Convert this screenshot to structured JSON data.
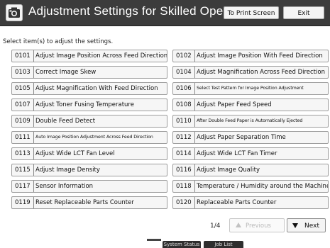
{
  "header": {
    "title": "Adjustment Settings for Skilled Operators",
    "icon": "operator-panel-icon",
    "print_screen_label": "To Print Screen",
    "exit_label": "Exit",
    "colors": {
      "bar": "#3c3c3c",
      "title_text": "#ffffff"
    }
  },
  "instruction": "Select item(s) to adjust the settings.",
  "items": [
    {
      "code": "0101",
      "label": "Adjust Image Position Across Feed Direction"
    },
    {
      "code": "0102",
      "label": "Adjust Image Position With Feed Direction"
    },
    {
      "code": "0103",
      "label": "Correct Image Skew"
    },
    {
      "code": "0104",
      "label": "Adjust Magnification Across Feed Direction"
    },
    {
      "code": "0105",
      "label": "Adjust Magnification With Feed Direction"
    },
    {
      "code": "0106",
      "label": "Select Test Pattern for Image Position Adjustment"
    },
    {
      "code": "0107",
      "label": "Adjust Toner Fusing Temperature"
    },
    {
      "code": "0108",
      "label": "Adjust Paper Feed Speed"
    },
    {
      "code": "0109",
      "label": "Double Feed Detect"
    },
    {
      "code": "0110",
      "label": "After Double Feed Paper is Automatically Ejected"
    },
    {
      "code": "0111",
      "label": "Auto Image Position Adjustment Across Feed Direction"
    },
    {
      "code": "0112",
      "label": "Adjust Paper Separation Time"
    },
    {
      "code": "0113",
      "label": "Adjust Wide LCT Fan Level"
    },
    {
      "code": "0114",
      "label": "Adjust Wide LCT Fan Timer"
    },
    {
      "code": "0115",
      "label": "Adjust Image Density"
    },
    {
      "code": "0116",
      "label": "Adjust Image Quality"
    },
    {
      "code": "0117",
      "label": "Sensor Information"
    },
    {
      "code": "0118",
      "label": "Temperature / Humidity around the Machine"
    },
    {
      "code": "0119",
      "label": "Reset Replaceable Parts Counter"
    },
    {
      "code": "0120",
      "label": "Replaceable Parts Counter"
    }
  ],
  "pagination": {
    "indicator": "1/4",
    "previous_label": "Previous",
    "next_label": "Next"
  },
  "statusbar": {
    "system_status": "System Status",
    "job_list": "Job List"
  }
}
